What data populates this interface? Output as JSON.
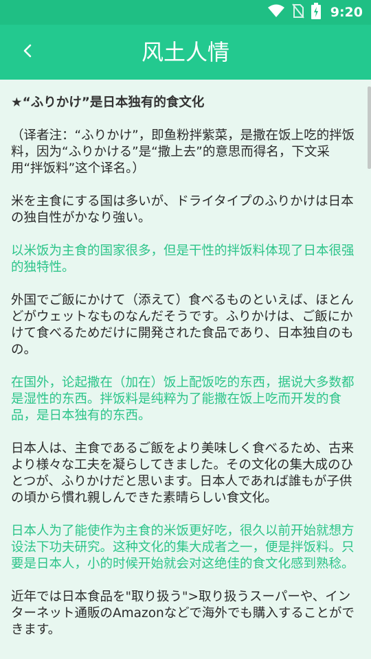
{
  "status_bar": {
    "time": "9:20"
  },
  "app_bar": {
    "title": "风土人情"
  },
  "article": {
    "paragraphs": [
      {
        "kind": "head",
        "text": "★“ふりかけ”是日本独有的食文化"
      },
      {
        "kind": "jp",
        "text": "（译者注：“ふりかけ”，即鱼粉拌紫菜，是撒在饭上吃的拌饭料，因为“ふりかける”是“撒上去”的意思而得名，下文采用“拌饭料”这个译名。）"
      },
      {
        "kind": "jp",
        "text": "米を主食にする国は多いが、ドライタイプのふりかけは日本の独自性がかなり強い。"
      },
      {
        "kind": "cn",
        "text": "以米饭为主食的国家很多，但是干性的拌饭料体现了日本很强的独特性。"
      },
      {
        "kind": "jp",
        "text": "外国でご飯にかけて（添えて）食べるものといえば、ほとんどがウェットなものなんだそうです。ふりかけは、ご飯にかけて食べるためだけに開発された食品であり、日本独自のもの。"
      },
      {
        "kind": "cn",
        "text": "在国外，论起撒在（加在）饭上配饭吃的东西，据说大多数都是湿性的东西。拌饭料是纯粹为了能撒在饭上吃而开发的食品，是日本独有的东西。"
      },
      {
        "kind": "jp",
        "text": "日本人は、主食であるご飯をより美味しく食べるため、古来より様々な工夫を凝らしてきました。その文化の集大成のひとつが、ふりかけだと思います。日本人であれば誰もが子供の頃から慣れ親しんできた素晴らしい食文化。"
      },
      {
        "kind": "cn",
        "text": "日本人为了能使作为主食的米饭更好吃，很久以前开始就想方设法下功夫研究。这种文化的集大成者之一，便是拌饭料。只要是日本人，小的时候开始就会对这绝佳的食文化感到熟稔。"
      },
      {
        "kind": "jp",
        "text": "近年では日本食品を\"取り扱う\">取り扱うスーパーや、インターネット通販のAmazonなどで海外でも購入することができます。"
      }
    ]
  }
}
